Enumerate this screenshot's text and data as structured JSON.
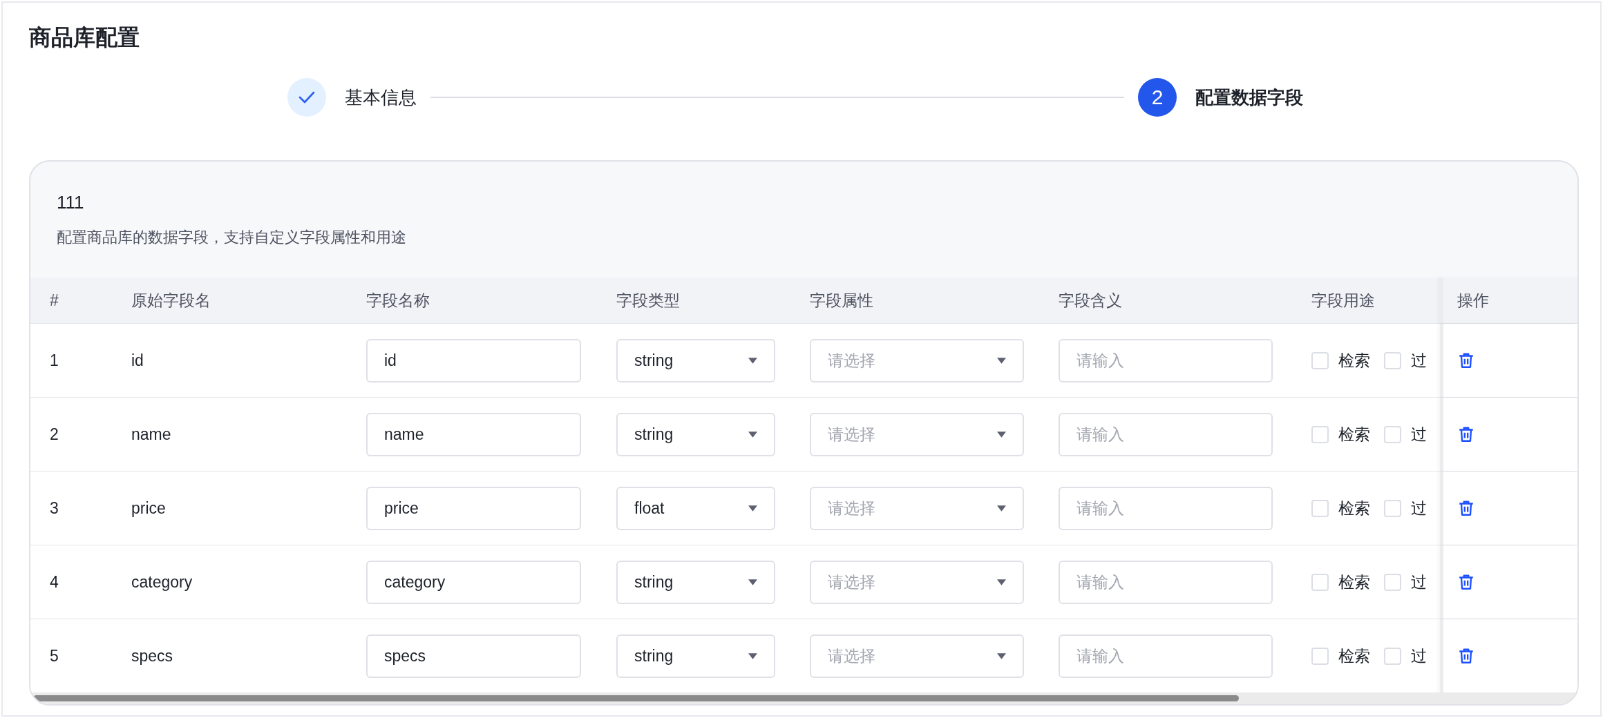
{
  "page": {
    "title": "商品库配置"
  },
  "steps": [
    {
      "label": "基本信息",
      "done": true,
      "current": false
    },
    {
      "label": "配置数据字段",
      "done": false,
      "current": true,
      "number": "2"
    }
  ],
  "panel": {
    "title": "111",
    "description": "配置商品库的数据字段，支持自定义字段属性和用途"
  },
  "table": {
    "columns": [
      "#",
      "原始字段名",
      "字段名称",
      "字段类型",
      "字段属性",
      "字段含义",
      "字段用途",
      "操作"
    ],
    "rows": [
      {
        "index": "1",
        "original": "id",
        "name": "id",
        "type": "string",
        "attribute_placeholder": "请选择",
        "meaning_placeholder": "请输入",
        "usages": [
          {
            "label": "检索",
            "checked": false
          },
          {
            "label": "过",
            "checked": false
          }
        ]
      },
      {
        "index": "2",
        "original": "name",
        "name": "name",
        "type": "string",
        "attribute_placeholder": "请选择",
        "meaning_placeholder": "请输入",
        "usages": [
          {
            "label": "检索",
            "checked": false
          },
          {
            "label": "过",
            "checked": false
          }
        ]
      },
      {
        "index": "3",
        "original": "price",
        "name": "price",
        "type": "float",
        "attribute_placeholder": "请选择",
        "meaning_placeholder": "请输入",
        "usages": [
          {
            "label": "检索",
            "checked": false
          },
          {
            "label": "过",
            "checked": false
          }
        ]
      },
      {
        "index": "4",
        "original": "category",
        "name": "category",
        "type": "string",
        "attribute_placeholder": "请选择",
        "meaning_placeholder": "请输入",
        "usages": [
          {
            "label": "检索",
            "checked": false
          },
          {
            "label": "过",
            "checked": false
          }
        ]
      },
      {
        "index": "5",
        "original": "specs",
        "name": "specs",
        "type": "string",
        "attribute_placeholder": "请选择",
        "meaning_placeholder": "请输入",
        "usages": [
          {
            "label": "检索",
            "checked": false
          },
          {
            "label": "过",
            "checked": false
          }
        ]
      }
    ]
  }
}
